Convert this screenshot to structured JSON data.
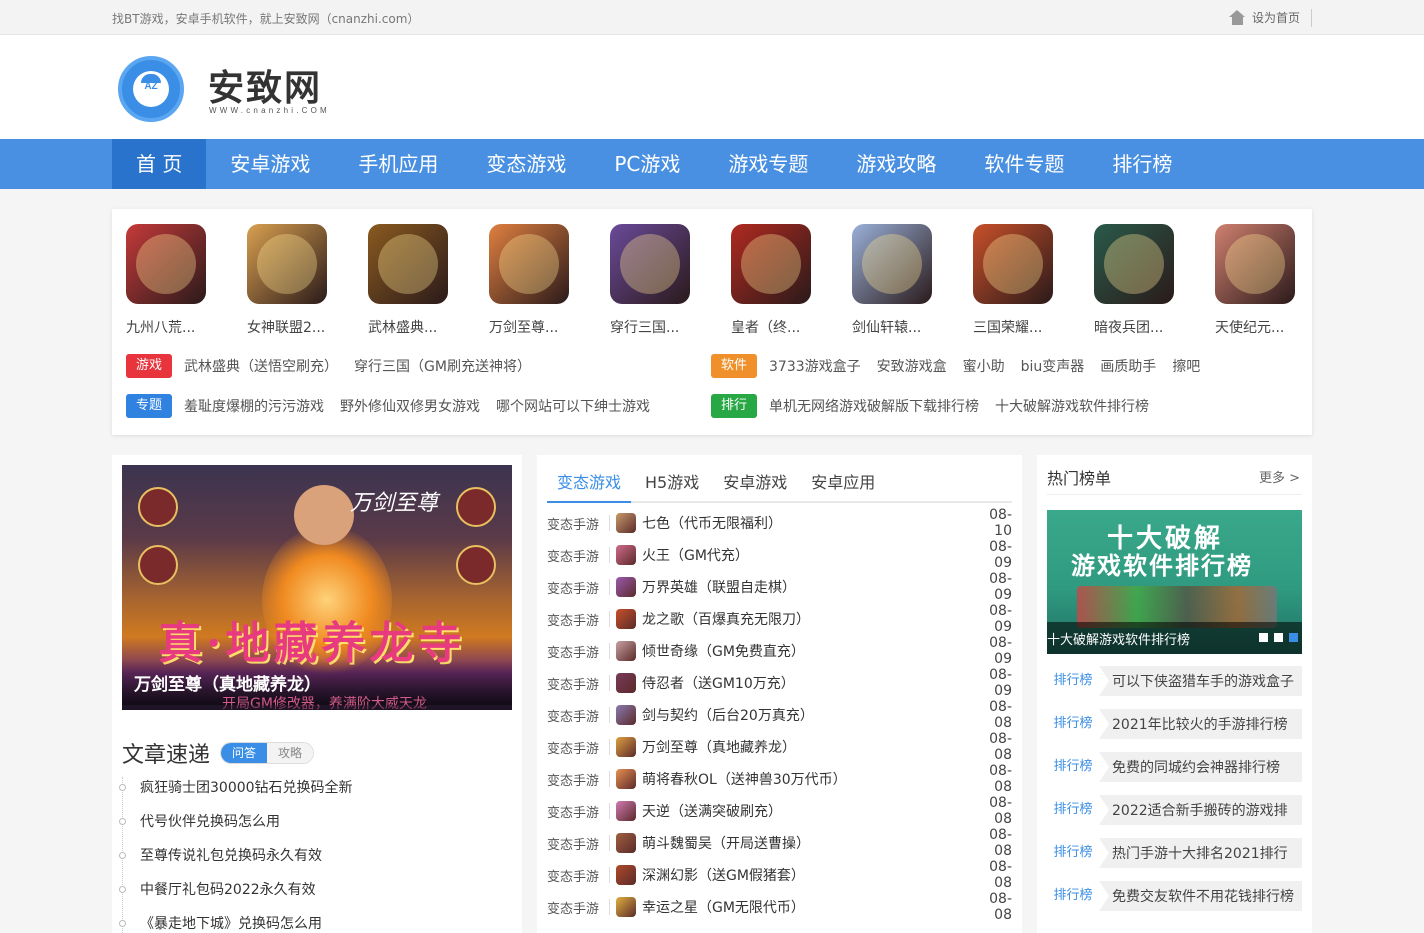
{
  "topbar": {
    "tagline": "找BT游戏，安卓手机软件，就上安致网（cnanzhi.com）",
    "sethome": "设为首页"
  },
  "logo": {
    "title": "安致网",
    "sub": "WWW.cnanzhi.COM",
    "badge": "AZ"
  },
  "nav": [
    "首 页",
    "安卓游戏",
    "手机应用",
    "变态游戏",
    "PC游戏",
    "游戏专题",
    "游戏攻略",
    "软件专题",
    "排行榜"
  ],
  "games": [
    {
      "name": "九州八荒...",
      "color": "#c53a3a"
    },
    {
      "name": "女神联盟2...",
      "color": "#d9a050"
    },
    {
      "name": "武林盛典...",
      "color": "#8a5a20"
    },
    {
      "name": "万剑至尊...",
      "color": "#e08040"
    },
    {
      "name": "穿行三国...",
      "color": "#6a4a9a"
    },
    {
      "name": "皇者（终...",
      "color": "#b02a20"
    },
    {
      "name": "剑仙轩辕...",
      "color": "#9ab0d8"
    },
    {
      "name": "三国荣耀...",
      "color": "#c8502a"
    },
    {
      "name": "暗夜兵团...",
      "color": "#2a5a4a"
    },
    {
      "name": "天使纪元...",
      "color": "#d08070"
    }
  ],
  "tags": {
    "game": {
      "label": "游戏",
      "links": [
        "武林盛典（送悟空刷充）",
        "穿行三国（GM刷充送神将）"
      ]
    },
    "software": {
      "label": "软件",
      "links": [
        "3733游戏盒子",
        "安致游戏盒",
        "蜜小助",
        "biu变声器",
        "画质助手",
        "擦吧"
      ]
    },
    "topic": {
      "label": "专题",
      "links": [
        "羞耻度爆棚的污污游戏",
        "野外修仙双修男女游戏",
        "哪个网站可以下绅士游戏"
      ]
    },
    "rank": {
      "label": "排行",
      "links": [
        "单机无网络游戏破解版下载排行榜",
        "十大破解游戏软件排行榜"
      ]
    }
  },
  "banner": {
    "brand": "万剑至尊",
    "headline": "真·地藏养龙寺",
    "caption": "万剑至尊（真地藏养龙）",
    "subcaption": "开局GM修改器，养满阶大威天龙",
    "progress": 0.2
  },
  "articles": {
    "title": "文章速递",
    "tabs": [
      "问答",
      "攻略"
    ],
    "items": [
      "疯狂骑士团30000钻石兑换码全新",
      "代号伙伴兑换码怎么用",
      "至尊传说礼包兑换码永久有效",
      "中餐厅礼包码2022永久有效",
      "《暴走地下城》兑换码怎么用"
    ]
  },
  "middle": {
    "tabs": [
      "变态游戏",
      "H5游戏",
      "安卓游戏",
      "安卓应用"
    ],
    "rows": [
      {
        "cat": "变态手游",
        "title": "七色（代币无限福利）",
        "date": "08-10",
        "color": "#c89a6a"
      },
      {
        "cat": "变态手游",
        "title": "火王（GM代充）",
        "date": "08-09",
        "color": "#d06a8a"
      },
      {
        "cat": "变态手游",
        "title": "万界英雄（联盟自走棋）",
        "date": "08-09",
        "color": "#9a5ab0"
      },
      {
        "cat": "变态手游",
        "title": "龙之歌（百爆真充无限刀）",
        "date": "08-09",
        "color": "#c8502a"
      },
      {
        "cat": "变态手游",
        "title": "倾世奇缘（GM免费直充）",
        "date": "08-09",
        "color": "#c8a0a0"
      },
      {
        "cat": "变态手游",
        "title": "侍忍者（送GM10万充）",
        "date": "08-09",
        "color": "#7a3a5a"
      },
      {
        "cat": "变态手游",
        "title": "剑与契约（后台20万真充）",
        "date": "08-08",
        "color": "#8a7ab0"
      },
      {
        "cat": "变态手游",
        "title": "万剑至尊（真地藏养龙）",
        "date": "08-08",
        "color": "#e0a040"
      },
      {
        "cat": "变态手游",
        "title": "萌将春秋OL（送神兽30万代币）",
        "date": "08-08",
        "color": "#e89050"
      },
      {
        "cat": "变态手游",
        "title": "天逆（送满突破刷充）",
        "date": "08-08",
        "color": "#d07ab0"
      },
      {
        "cat": "变态手游",
        "title": "萌斗魏蜀吴（开局送曹操）",
        "date": "08-08",
        "color": "#a06040"
      },
      {
        "cat": "变态手游",
        "title": "深渊幻影（送GM假猪套）",
        "date": "08-08",
        "color": "#b04a2a"
      },
      {
        "cat": "变态手游",
        "title": "幸运之星（GM无限代币）",
        "date": "08-08",
        "color": "#e0b040"
      }
    ]
  },
  "hot": {
    "title": "热门榜单",
    "more": "更多 >",
    "banner_line1": "十大破解",
    "banner_line2": "游戏软件排行榜",
    "banner_caption": "十大破解游戏软件排行榜",
    "label": "排行榜",
    "items": [
      "可以下侠盗猎车手的游戏盒子",
      "2021年比较火的手游排行榜",
      "免费的同城约会神器排行榜",
      "2022适合新手搬砖的游戏排",
      "热门手游十大排名2021排行",
      "免费交友软件不用花钱排行榜"
    ]
  }
}
